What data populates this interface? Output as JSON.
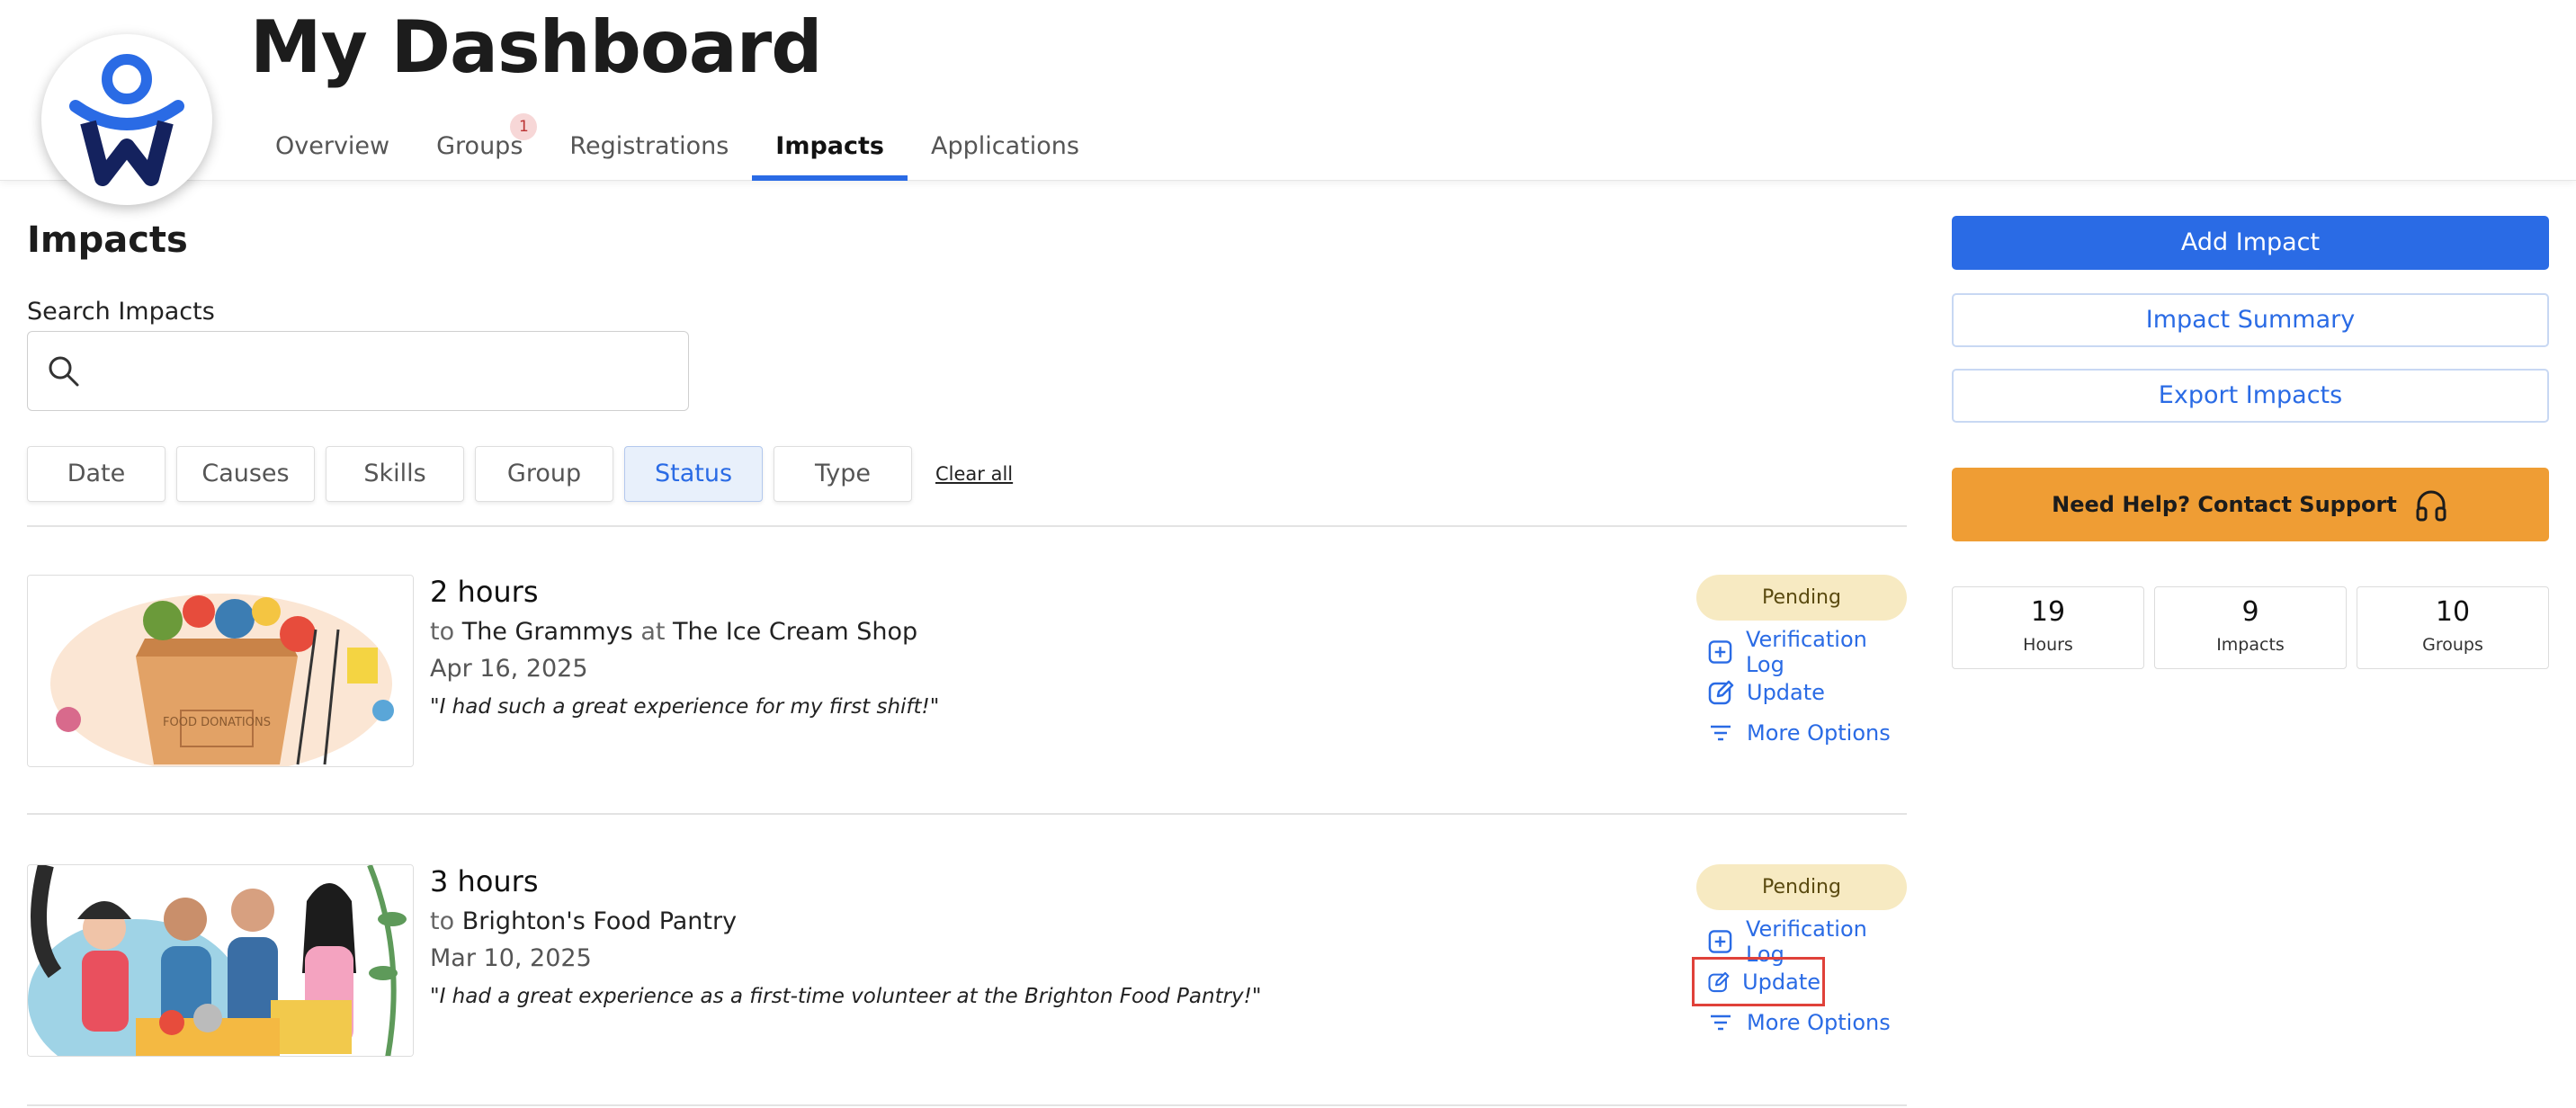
{
  "header": {
    "title": "My Dashboard",
    "tabs": [
      {
        "label": "Overview"
      },
      {
        "label": "Groups",
        "badge": "1"
      },
      {
        "label": "Registrations"
      },
      {
        "label": "Impacts",
        "active": true
      },
      {
        "label": "Applications"
      }
    ]
  },
  "main": {
    "section_title": "Impacts",
    "search": {
      "label": "Search Impacts",
      "value": "",
      "placeholder": ""
    },
    "filters": [
      "Date",
      "Causes",
      "Skills",
      "Group",
      "Status",
      "Type"
    ],
    "active_filter": "Status",
    "clear_all": "Clear all",
    "impacts": [
      {
        "hours": "2 hours",
        "to_prefix": "to",
        "org": "The Grammys",
        "at_prefix": "at",
        "location": "The Ice Cream Shop",
        "date": "Apr 16, 2025",
        "quote": "\"I had such a great experience for my first shift!\"",
        "status": "Pending",
        "image_caption": "FOOD DONATIONS",
        "actions": {
          "verification_log": "Verification Log",
          "update": "Update",
          "more_options": "More Options"
        }
      },
      {
        "hours": "3 hours",
        "to_prefix": "to",
        "org": "Brighton's Food Pantry",
        "date": "Mar 10, 2025",
        "quote": "\"I had a great experience as a first-time volunteer at the Brighton Food Pantry!\"",
        "status": "Pending",
        "actions": {
          "verification_log": "Verification Log",
          "update": "Update",
          "more_options": "More Options"
        }
      }
    ]
  },
  "sidebar": {
    "add_impact": "Add Impact",
    "impact_summary": "Impact Summary",
    "export_impacts": "Export Impacts",
    "help": "Need Help? Contact Support",
    "stats": [
      {
        "value": "19",
        "label": "Hours"
      },
      {
        "value": "9",
        "label": "Impacts"
      },
      {
        "value": "10",
        "label": "Groups"
      }
    ]
  },
  "colors": {
    "accent": "#2a6be5",
    "help": "#ef9d34",
    "pending": "#f7eac2",
    "highlight": "#e0413a"
  }
}
